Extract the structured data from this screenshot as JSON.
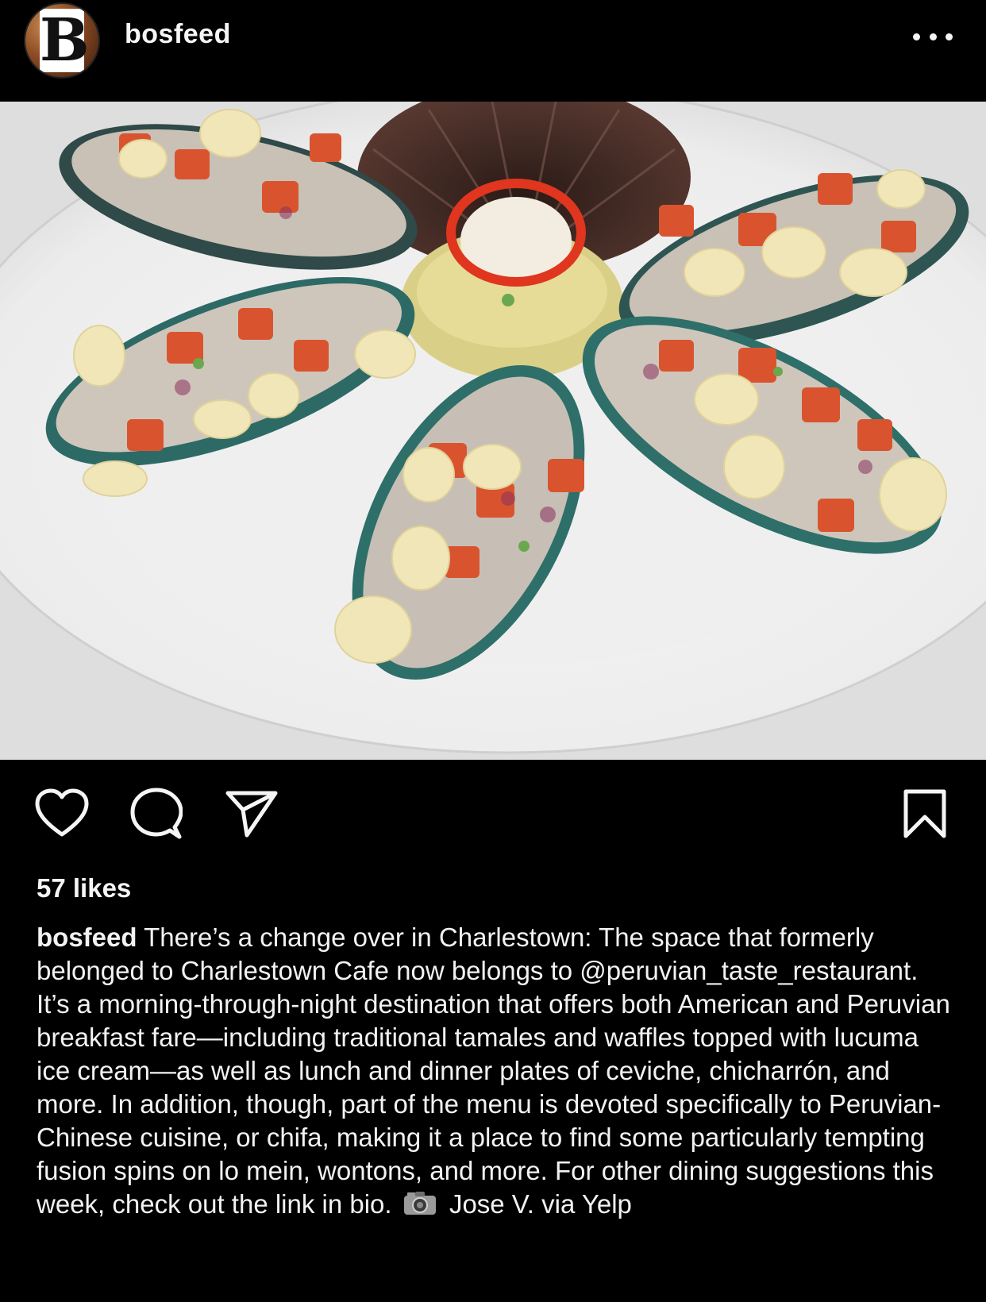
{
  "post": {
    "username": "bosfeed",
    "avatar_letter": "B",
    "likes": "57 likes",
    "caption": {
      "username": "bosfeed",
      "text": "There’s a change over in Charlestown: The space that formerly belonged to Charlestown Cafe now belongs to @peruvian_taste_restaurant. It’s a morning-through-night destination that offers both American and Peruvian breakfast fare—including traditional tamales and waffles topped with lucuma ice cream—as well as lunch and dinner plates of ceviche, chicharrón, and more. In addition, though, part of the menu is devoted specifically to Peruvian-Chinese cuisine, or chifa, making it a place to find some particularly tempting fusion spins on lo mein, wontons, and more. For other dining suggestions this week, check out the link in bio.",
      "credit": "Jose V. via Yelp"
    }
  },
  "icons": {
    "more": "more-options-icon",
    "like": "heart-icon",
    "comment": "comment-icon",
    "share": "paper-plane-icon",
    "save": "bookmark-icon",
    "camera": "camera-icon"
  },
  "colors": {
    "background": "#000000",
    "text": "#f5f5f5"
  }
}
